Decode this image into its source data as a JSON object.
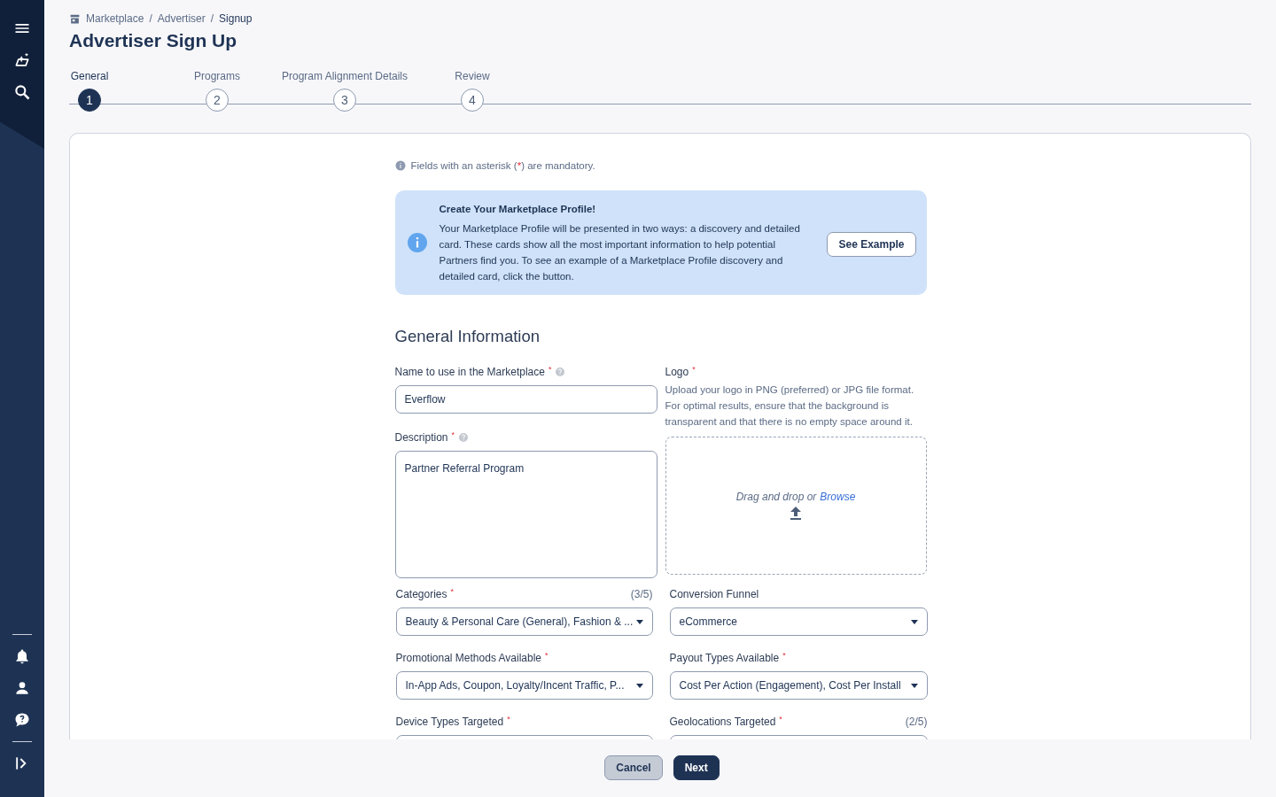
{
  "breadcrumb": [
    {
      "label": "Marketplace",
      "current": false
    },
    {
      "label": "Advertiser",
      "current": false
    },
    {
      "label": "Signup",
      "current": true
    }
  ],
  "breadcrumb_separator": "/",
  "title": "Advertiser Sign Up",
  "steps": [
    {
      "label": "General",
      "number": "1",
      "selected": true
    },
    {
      "label": "Programs",
      "number": "2",
      "selected": false
    },
    {
      "label": "Program Alignment Details",
      "number": "3",
      "selected": false
    },
    {
      "label": "Review",
      "number": "4",
      "selected": false
    }
  ],
  "mandatory_note": {
    "before": "Fields with an asterisk (",
    "mark": "*",
    "after": ") are mandatory."
  },
  "info_banner": {
    "title": "Create Your Marketplace Profile!",
    "text": "Your Marketplace Profile will be presented in two ways: a discovery and detailed card. These cards show all the most important information to help potential Partners find you. To see an example of a Marketplace Profile discovery and detailed card, click the button.",
    "button": "See Example"
  },
  "section_title": "General Information",
  "name_field": {
    "label": "Name to use in the Marketplace",
    "mark": "*",
    "help": true,
    "value": "Everflow"
  },
  "description_field": {
    "label": "Description",
    "mark": "*",
    "help": true,
    "value": "Partner Referral Program"
  },
  "logo": {
    "label": "Logo",
    "mark": "*",
    "hint": "Upload your logo in PNG (preferred) or JPG file format. For optimal results, ensure that the background is transparent and that there is no empty space around it.",
    "drop_text": "Drag and drop or",
    "browse": "Browse"
  },
  "select_fields": [
    {
      "label": "Categories",
      "mark": "*",
      "count": "(3/5)",
      "value": "Beauty & Personal Care (General), Fashion & ..."
    },
    {
      "label": "Conversion Funnel",
      "value": "eCommerce"
    },
    {
      "label": "Promotional Methods Available",
      "mark": "*",
      "value": "In-App Ads, Coupon, Loyalty/Incent Traffic, P..."
    },
    {
      "label": "Payout Types Available",
      "mark": "*",
      "value": "Cost Per Action (Engagement), Cost Per Install"
    },
    {
      "label": "Device Types Targeted",
      "mark": "*"
    },
    {
      "label": "Geolocations Targeted",
      "mark": "*",
      "count": "(2/5)"
    }
  ],
  "buttons": [
    {
      "label": "Cancel",
      "kind": "secondary"
    },
    {
      "label": "Next",
      "kind": "primary"
    }
  ]
}
